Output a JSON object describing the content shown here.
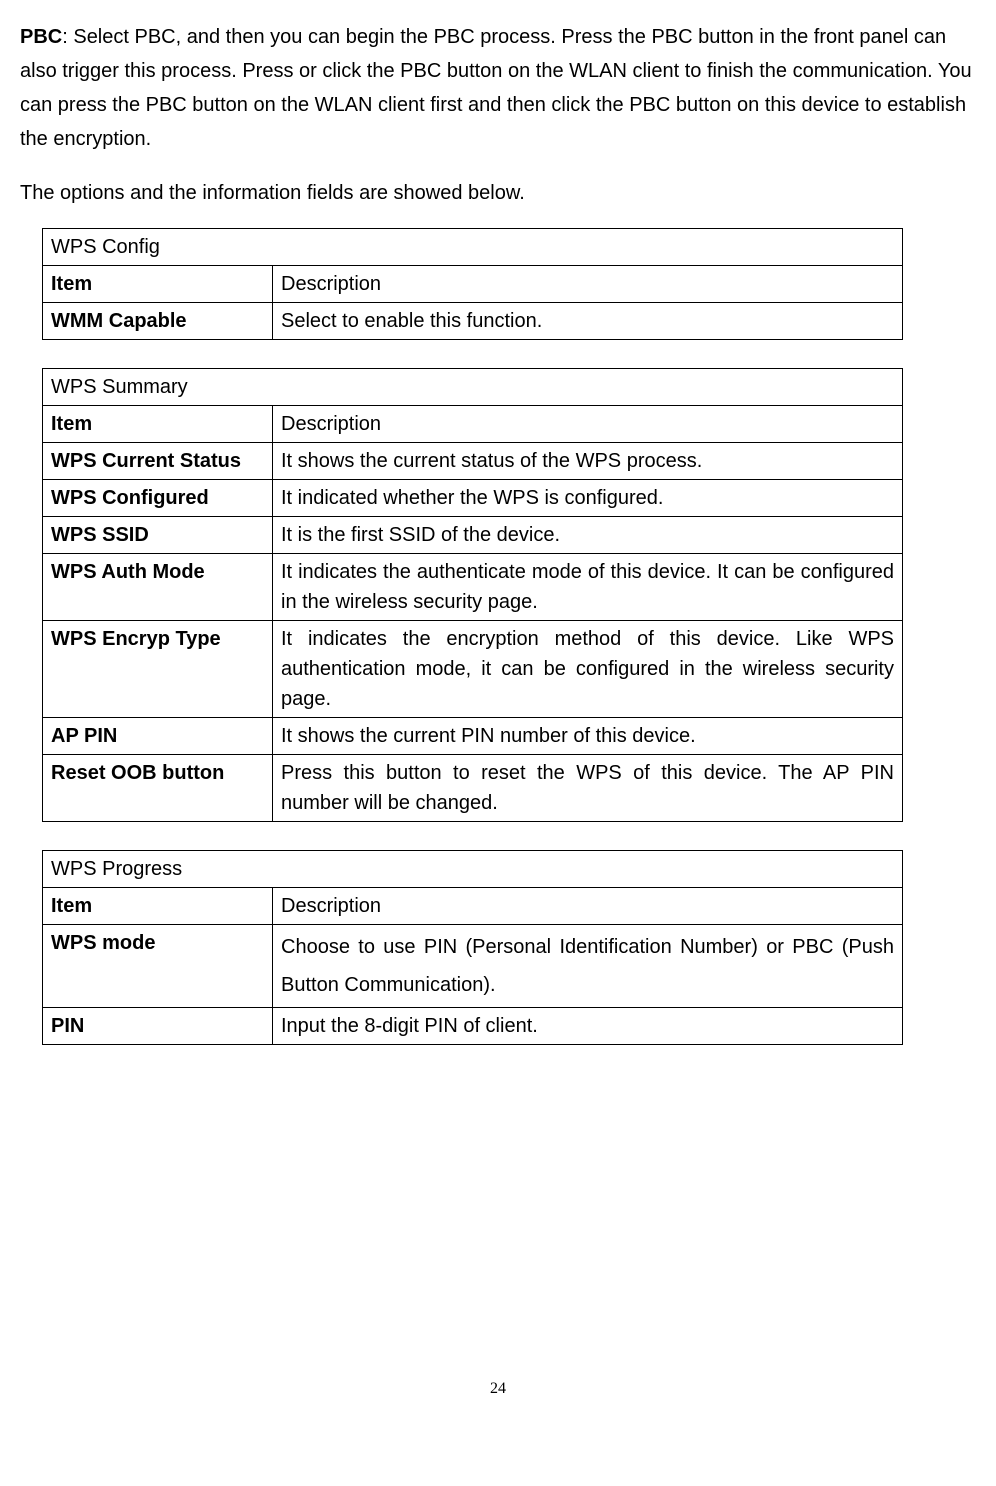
{
  "intro": {
    "pbc_bold": "PBC",
    "pbc_rest": ": Select PBC, and then you can begin the PBC process. Press the PBC button in the front panel can also trigger this process. Press or click the PBC button on the WLAN client to finish the communication. You can press the PBC button on the WLAN client first and then click the PBC button on this device to establish the encryption.",
    "options_line": "The options and the information fields are showed below."
  },
  "tables": {
    "wps_config": {
      "title": "WPS Config",
      "header_item": "Item",
      "header_desc": "Description",
      "rows": [
        {
          "item": "WMM Capable",
          "desc": "Select to enable this function."
        }
      ]
    },
    "wps_summary": {
      "title": "WPS Summary",
      "header_item": "Item",
      "header_desc": "Description",
      "rows": [
        {
          "item": "WPS Current Status",
          "desc": "It shows the current status of the WPS process."
        },
        {
          "item": "WPS Configured",
          "desc": "It indicated whether the WPS is configured."
        },
        {
          "item": "WPS SSID",
          "desc": "It is the first SSID of the device."
        },
        {
          "item": "WPS Auth Mode",
          "desc": "It indicates the authenticate mode of this device. It can be configured in the wireless security page."
        },
        {
          "item": "WPS Encryp Type",
          "desc": "It indicates the encryption method of this device. Like WPS authentication mode, it can be configured in the wireless security page."
        },
        {
          "item": "AP PIN",
          "desc": "It shows the current PIN number of this device."
        },
        {
          "item": "Reset OOB button",
          "desc": "Press this button to reset the WPS of this device. The AP PIN number will be changed."
        }
      ]
    },
    "wps_progress": {
      "title": "WPS Progress",
      "header_item": "Item",
      "header_desc": "Description",
      "rows": [
        {
          "item": "WPS mode",
          "desc": "Choose to use PIN (Personal Identification Number) or PBC (Push Button Communication)."
        },
        {
          "item": "PIN",
          "desc": "Input the 8-digit PIN of client."
        }
      ]
    }
  },
  "page_number": "24"
}
